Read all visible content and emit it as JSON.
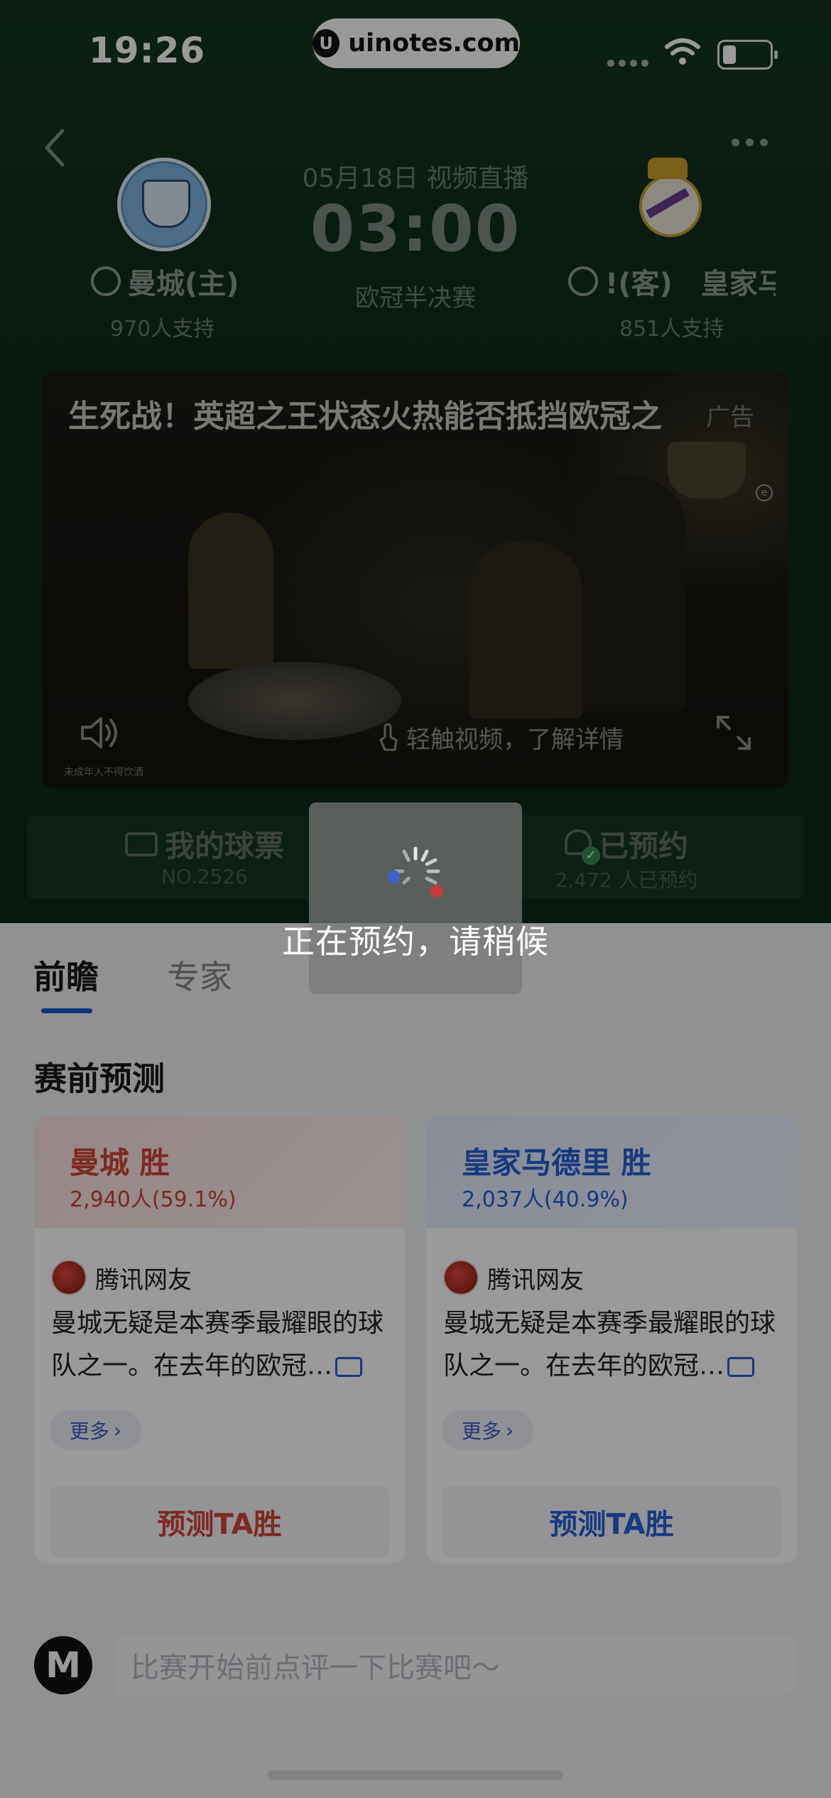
{
  "status_bar": {
    "time": "19:26",
    "site_badge": "uinotes.com"
  },
  "match": {
    "date_label": "05月18日 视频直播",
    "kickoff": "03:00",
    "stage": "欧冠半决赛",
    "home": {
      "name": "曼城(主)",
      "support": "970人支持"
    },
    "away": {
      "name": "皇家马德里(客)",
      "name_visible": "!(客)　皇家马",
      "support": "851人支持"
    }
  },
  "video_ad": {
    "title": "生死战！英超之王状态火热能否抵挡欧冠之",
    "ad_label": "广告",
    "hint": "轻触视频，了解详情",
    "minor_warning": "未成年人不得饮酒"
  },
  "actions": {
    "ticket": {
      "label": "我的球票",
      "sub": "NO.2526"
    },
    "reserve": {
      "label": "已预约",
      "sub": "2,472 人已预约"
    }
  },
  "tabs": [
    {
      "label": "前瞻",
      "active": true
    },
    {
      "label": "专家",
      "active": false
    }
  ],
  "section_title": "赛前预测",
  "predictions": [
    {
      "pick": "曼城 胜",
      "stat": "2,940人(59.1%)",
      "user": "腾讯网友",
      "text_line1": "曼城无疑是本赛季最耀眼的球",
      "text_line2": "队之一。在去年的欧冠…",
      "more": "更多",
      "button": "预测TA胜",
      "color": "#d0463c"
    },
    {
      "pick": "皇家马德里 胜",
      "stat": "2,037人(40.9%)",
      "user": "腾讯网友",
      "text_line1": "曼城无疑是本赛季最耀眼的球",
      "text_line2": "队之一。在去年的欧冠…",
      "more": "更多",
      "button": "预测TA胜",
      "color": "#2a5fd6"
    }
  ],
  "comment": {
    "logo": "M",
    "placeholder": "比赛开始前点评一下比赛吧～"
  },
  "overlay": {
    "loading": "加载中…",
    "message": "正在预约，请稍候"
  }
}
